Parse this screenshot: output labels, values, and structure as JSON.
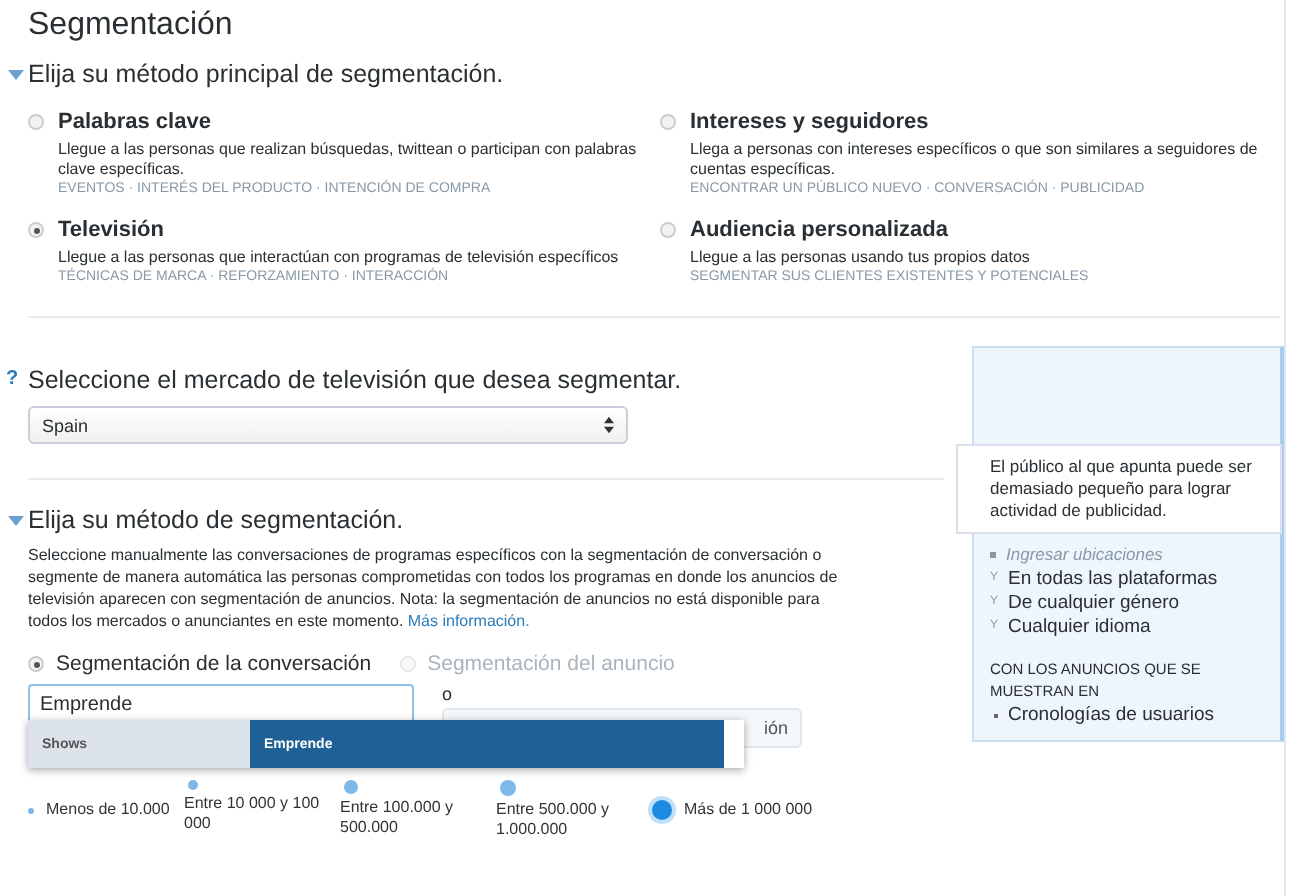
{
  "title": "Segmentación",
  "primary_method": {
    "heading": "Elija su método principal de segmentación.",
    "expanded": true,
    "options": [
      {
        "title": "Palabras clave",
        "description": "Llegue a las personas que realizan búsquedas, twittean o participan con palabras clave específicas.",
        "tags": "EVENTOS · INTERÉS DEL PRODUCTO · INTENCIÓN DE COMPRA",
        "selected": false
      },
      {
        "title": "Intereses y seguidores",
        "description": "Llega a personas con intereses específicos o que son similares a seguidores de cuentas específicas.",
        "tags": "ENCONTRAR UN PÚBLICO NUEVO · CONVERSACIÓN · PUBLICIDAD",
        "selected": false
      },
      {
        "title": "Televisión",
        "description": "Llegue a las personas que interactúan con programas de televisión específicos",
        "tags": "TÉCNICAS DE MARCA · REFORZAMIENTO · INTERACCIÓN",
        "selected": true
      },
      {
        "title": "Audiencia personalizada",
        "description": "Llegue a las personas usando tus propios datos",
        "tags": "SEGMENTAR SUS CLIENTES EXISTENTES Y POTENCIALES",
        "selected": false
      }
    ]
  },
  "market": {
    "help": "?",
    "heading": "Seleccione el mercado de televisión que desea segmentar.",
    "value": "Spain"
  },
  "method": {
    "heading": "Elija su método de segmentación.",
    "expanded": true,
    "description": "Seleccione manualmente las conversaciones de programas específicos con la segmentación de conversación o segmente de manera automática las personas comprometidas con todos los programas en donde los anuncios de televisión aparecen con segmentación de anuncios. Nota: la segmentación de anuncios no está disponible para todos los mercados o anunciantes en este momento.",
    "link": "Más información.",
    "modes": [
      {
        "label": "Segmentación de la conversación",
        "selected": true,
        "disabled": false
      },
      {
        "label": "Segmentación del anuncio",
        "selected": false,
        "disabled": true
      }
    ],
    "search_value": "Emprende",
    "or_label": "o",
    "button_label": "ión",
    "suggestions": {
      "category": "Shows",
      "items": [
        {
          "label": "Emprende",
          "selected": true
        }
      ]
    },
    "scale": [
      {
        "label": "Menos de 10.000",
        "selected": false
      },
      {
        "label": "Entre 10 000 y 100 000",
        "selected": false
      },
      {
        "label": "Entre 100.000 y 500.000",
        "selected": false
      },
      {
        "label": "Entre 500.000 y 1.000.000",
        "selected": false
      },
      {
        "label": "Más de 1 000 000",
        "selected": true
      }
    ]
  },
  "summary": {
    "locations": "Ingresar ubicaciones",
    "criteria": [
      {
        "prefix": "Y",
        "text": "En todas las plataformas"
      },
      {
        "prefix": "Y",
        "text": "De cualquier género"
      },
      {
        "prefix": "Y",
        "text": "Cualquier idioma"
      }
    ],
    "placements_heading": "CON LOS ANUNCIOS QUE SE MUESTRAN EN",
    "placements": [
      "Cronologías de usuarios"
    ]
  },
  "tooltip": "El público al que apunta puede ser demasiado pequeño para lograr actividad de publicidad."
}
